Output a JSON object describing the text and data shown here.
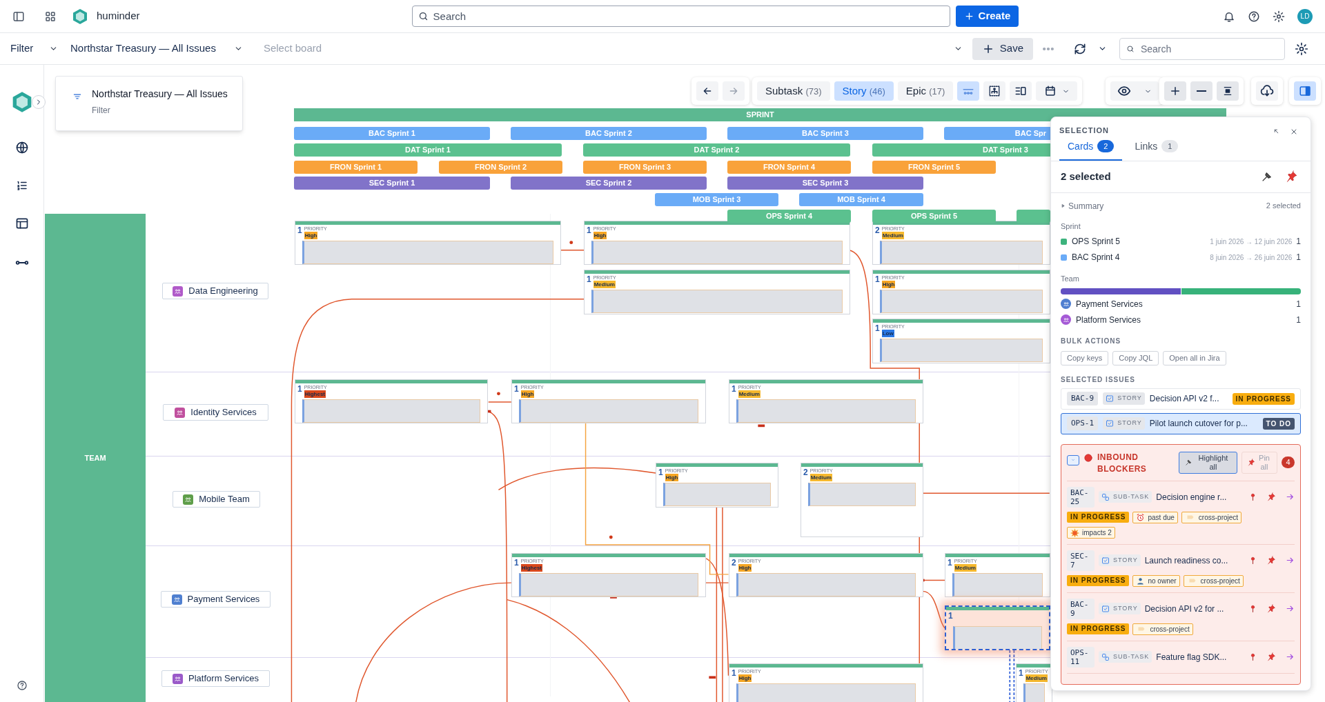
{
  "topbar": {
    "app_name": "huminder",
    "search_placeholder": "Search",
    "create_label": "Create",
    "avatar": "LD"
  },
  "filterbar": {
    "filter_label": "Filter",
    "board_name": "Northstar Treasury — All Issues",
    "board_placeholder": "Select board",
    "save_label": "Save",
    "search_placeholder": "Search"
  },
  "filter_card": {
    "title": "Northstar Treasury — All Issues",
    "subtitle": "Filter"
  },
  "toolbar": {
    "type_filters": [
      {
        "label": "Subtask",
        "count": "(73)",
        "selected": false
      },
      {
        "label": "Story",
        "count": "(46)",
        "selected": true
      },
      {
        "label": "Epic",
        "count": "(17)",
        "selected": false
      }
    ]
  },
  "timeline": {
    "header": "SPRINT",
    "sprints": [
      {
        "label": "BAC Sprint 1",
        "color": "#6aabf7"
      },
      {
        "label": "BAC Sprint 2",
        "color": "#6aabf7"
      },
      {
        "label": "BAC Sprint 3",
        "color": "#6aabf7"
      },
      {
        "label": "BAC Spr",
        "color": "#6aabf7"
      },
      {
        "label": "DAT Sprint 1",
        "color": "#5bc18f"
      },
      {
        "label": "DAT Sprint 2",
        "color": "#5bc18f"
      },
      {
        "label": "DAT Sprint 3",
        "color": "#5bc18f"
      },
      {
        "label": "FRON Sprint 1",
        "color": "#f9a23a"
      },
      {
        "label": "FRON Sprint 2",
        "color": "#f9a23a"
      },
      {
        "label": "FRON Sprint 3",
        "color": "#f9a23a"
      },
      {
        "label": "FRON Sprint 4",
        "color": "#f9a23a"
      },
      {
        "label": "FRON Sprint 5",
        "color": "#f9a23a"
      },
      {
        "label": "SEC Sprint 1",
        "color": "#8173c9"
      },
      {
        "label": "SEC Sprint 2",
        "color": "#8173c9"
      },
      {
        "label": "SEC Sprint 3",
        "color": "#8173c9"
      },
      {
        "label": "MOB Sprint 3",
        "color": "#6aabf7"
      },
      {
        "label": "MOB Sprint 4",
        "color": "#6aabf7"
      },
      {
        "label": "OPS Sprint 4",
        "color": "#5bc18f"
      },
      {
        "label": "OPS Sprint 5",
        "color": "#5bc18f"
      },
      {
        "color": "#5bc18f"
      }
    ]
  },
  "board": {
    "lane_label": "TEAM",
    "teams": [
      {
        "name": "Data Engineering",
        "color": "#b05ac9",
        "cards": [
          {
            "count": "1",
            "caption": "PRIORITY",
            "priority": "High",
            "color": "#f6a623",
            "selected": false
          },
          {
            "count": "1",
            "caption": "PRIORITY",
            "priority": "High",
            "color": "#f6a623",
            "selected": false
          },
          {
            "count": "1",
            "caption": "PRIORITY",
            "priority": "Medium",
            "color": "#f5b82e",
            "selected": false
          },
          {
            "count": "2",
            "caption": "PRIORITY",
            "priority": "Medium",
            "color": "#f5b82e",
            "selected": false
          },
          {
            "count": "1",
            "caption": "PRIORITY",
            "priority": "High",
            "color": "#f6a623",
            "selected": false
          },
          {
            "count": "1",
            "caption": "PRIORITY",
            "priority": "Low",
            "color": "#2b78e4",
            "selected": false
          }
        ]
      },
      {
        "name": "Identity Services",
        "color": "#c0509e",
        "cards": [
          {
            "count": "1",
            "caption": "PRIORITY",
            "priority": "Highest",
            "color": "#d9481c",
            "selected": false
          },
          {
            "count": "1",
            "caption": "PRIORITY",
            "priority": "High",
            "color": "#f6a623",
            "selected": false
          },
          {
            "count": "1",
            "caption": "PRIORITY",
            "priority": "Medium",
            "color": "#f5b82e",
            "selected": false
          }
        ]
      },
      {
        "name": "Mobile Team",
        "color": "#5f9e4a",
        "cards": [
          {
            "count": "1",
            "caption": "PRIORITY",
            "priority": "High",
            "color": "#f6a623",
            "selected": false
          },
          {
            "count": "2",
            "caption": "PRIORITY",
            "priority": "Medium",
            "color": "#f5b82e",
            "selected": false
          }
        ]
      },
      {
        "name": "Payment Services",
        "color": "#4f7fd0",
        "cards": [
          {
            "count": "1",
            "caption": "PRIORITY",
            "priority": "Highest",
            "color": "#d9481c",
            "selected": false
          },
          {
            "count": "2",
            "caption": "PRIORITY",
            "priority": "High",
            "color": "#f6a623",
            "selected": false
          },
          {
            "count": "1",
            "caption": "PRIORITY",
            "priority": "Medium",
            "color": "#f5b82e",
            "selected": false
          },
          {
            "count": "1",
            "selected": true
          }
        ]
      },
      {
        "name": "Platform Services",
        "color": "#9a5ac9",
        "cards": [
          {
            "count": "1",
            "caption": "PRIORITY",
            "priority": "High",
            "color": "#f6a623",
            "selected": false
          },
          {
            "count": "1",
            "caption": "PRIORITY",
            "priority": "Medium",
            "color": "#f5b82e",
            "selected": false
          }
        ]
      }
    ]
  },
  "selection_panel": {
    "title": "SELECTION",
    "tabs": [
      {
        "label": "Cards",
        "count": "2",
        "selected": true
      },
      {
        "label": "Links",
        "count": "1",
        "selected": false
      }
    ],
    "selected_count": "2 selected",
    "summary": {
      "label": "Summary",
      "expanded": false,
      "count": "2 selected"
    },
    "sprint_heading": "Sprint",
    "sprints": [
      {
        "name": "OPS Sprint 5",
        "color": "#3db37d",
        "dates": "1 juin 2026 → 12 juin 2026",
        "count": "1"
      },
      {
        "name": "BAC Sprint 4",
        "color": "#6aabf7",
        "dates": "8 juin 2026 → 26 juin 2026",
        "count": "1"
      }
    ],
    "team_heading": "Team",
    "team_bar": [
      {
        "color": "#6150c2"
      },
      {
        "color": "#37b27a"
      }
    ],
    "teams": [
      {
        "name": "Payment Services",
        "color": "#4f7fd0",
        "count": "1"
      },
      {
        "name": "Platform Services",
        "color": "#a55ad6",
        "count": "1"
      }
    ],
    "bulk_heading": "BULK ACTIONS",
    "bulk_actions": [
      "Copy keys",
      "Copy JQL",
      "Open all in Jira"
    ],
    "issues_heading": "SELECTED ISSUES",
    "issues": [
      {
        "key": "BAC-9",
        "type": "STORY",
        "title": "Decision API v2 f...",
        "status": "IN PROGRESS",
        "color": "#f8ad0f",
        "selected": false
      },
      {
        "key": "OPS-1",
        "type": "STORY",
        "title": "Pilot launch cutover for p...",
        "status": "TO DO",
        "color": "#44546f",
        "selected": true
      }
    ],
    "blockers": {
      "title": "INBOUND BLOCKERS",
      "highlight_label": "Highlight all",
      "highlight_on": true,
      "pin_label": "Pin all",
      "count": "4",
      "items": [
        {
          "key": "BAC-25",
          "type": "SUB-TASK",
          "kind": "subtask",
          "title": "Decision engine r...",
          "status": "IN PROGRESS",
          "tags": [
            {
              "kind": "past_due",
              "label": "past due"
            },
            {
              "kind": "cross_project",
              "label": "cross-project"
            },
            {
              "kind": "impacts",
              "label": "impacts 2"
            }
          ]
        },
        {
          "key": "SEC-7",
          "type": "STORY",
          "kind": "story",
          "title": "Launch readiness co...",
          "status": "IN PROGRESS",
          "tags": [
            {
              "kind": "no_owner",
              "label": "no owner"
            },
            {
              "kind": "cross_project",
              "label": "cross-project"
            }
          ]
        },
        {
          "key": "BAC-9",
          "type": "STORY",
          "kind": "story",
          "title": "Decision API v2 for ...",
          "status": "IN PROGRESS",
          "tags": [
            {
              "kind": "cross_project",
              "label": "cross-project"
            }
          ]
        },
        {
          "key": "OPS-11",
          "type": "SUB-TASK",
          "kind": "subtask",
          "title": "Feature flag SDK..."
        }
      ]
    }
  }
}
